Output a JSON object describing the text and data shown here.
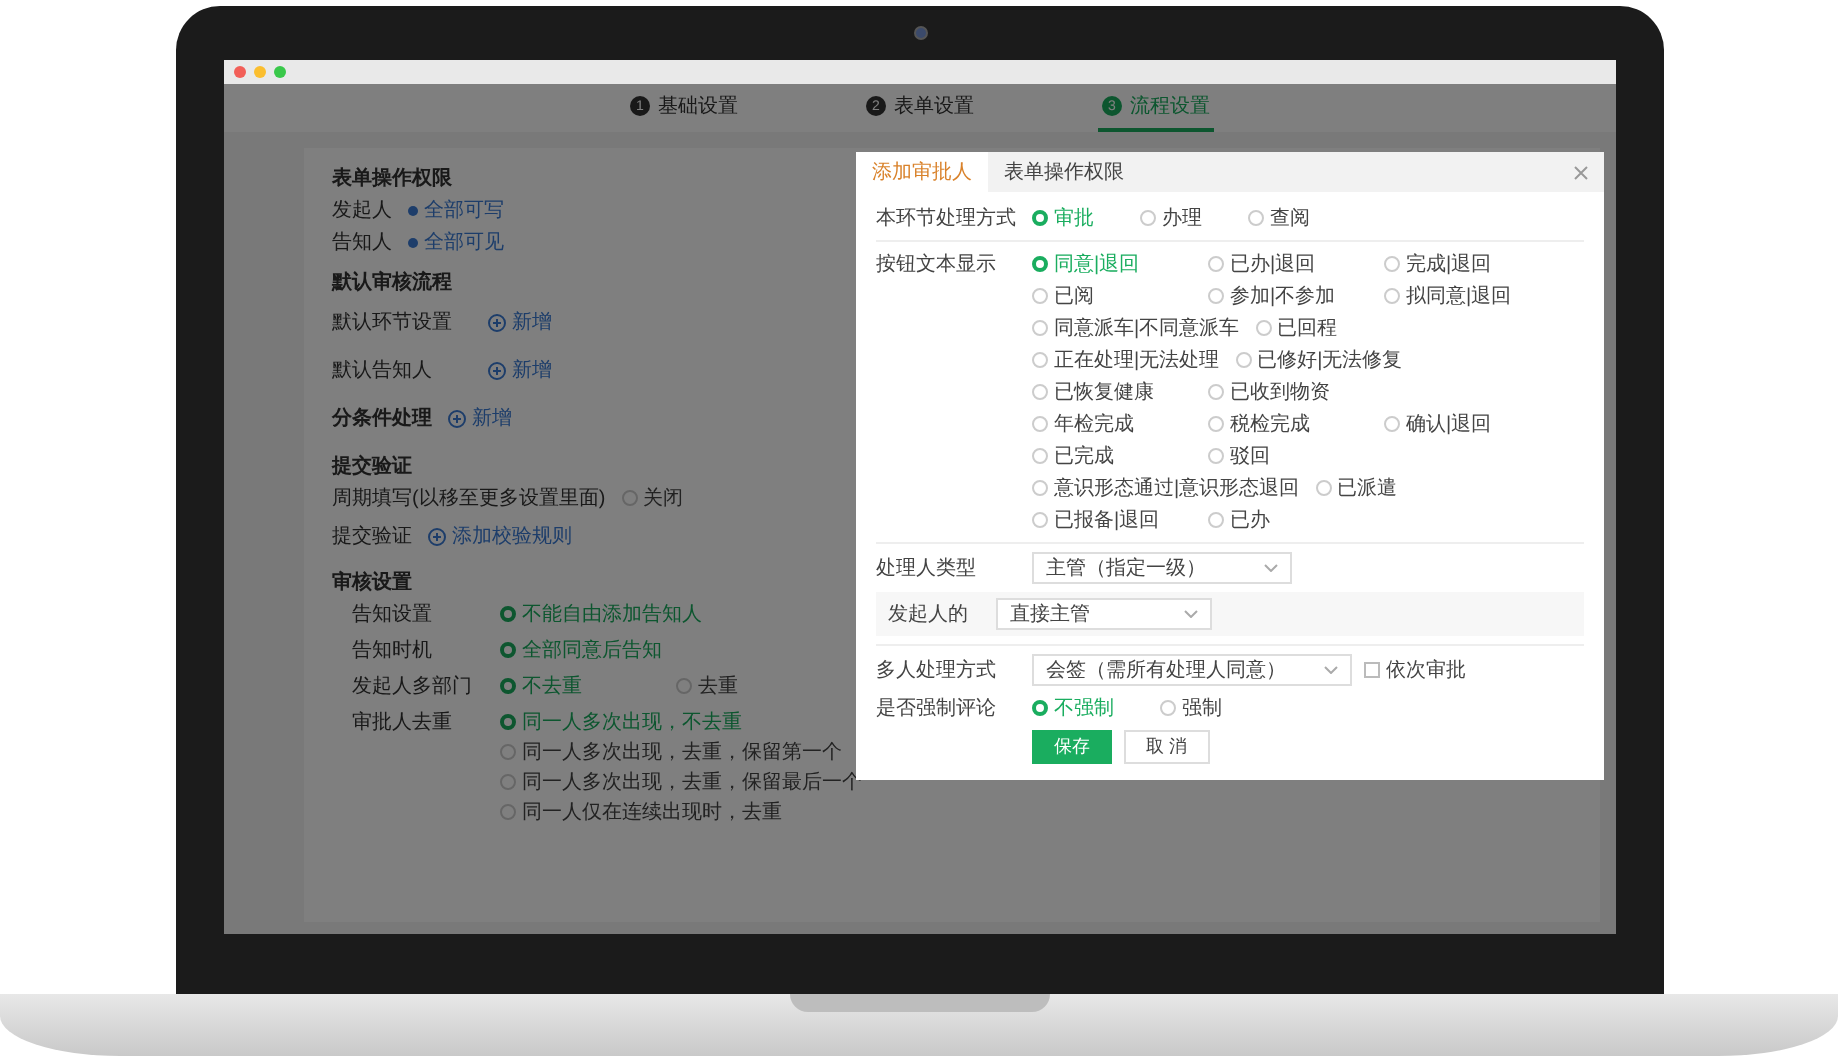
{
  "steps": [
    {
      "number": "1",
      "label": "基础设置",
      "selected": false
    },
    {
      "number": "2",
      "label": "表单设置",
      "selected": false
    },
    {
      "number": "3",
      "label": "流程设置",
      "selected": true
    }
  ],
  "form_permissions": {
    "title": "表单操作权限",
    "rows": [
      {
        "label": "发起人",
        "value": "全部可写"
      },
      {
        "label": "告知人",
        "value": "全部可见"
      }
    ]
  },
  "default_flow": {
    "title": "默认审核流程",
    "rows": [
      {
        "label": "默认环节设置",
        "action": "新增"
      },
      {
        "label": "默认告知人",
        "action": "新增"
      }
    ]
  },
  "branch": {
    "label": "分条件处理",
    "action": "新增"
  },
  "submit_check": {
    "title": "提交验证",
    "row_label": "周期填写(以移至更多设置里面)",
    "options": [
      {
        "label": "关闭",
        "selected": false
      }
    ]
  },
  "validation": {
    "label": "提交验证",
    "action": "添加校验规则"
  },
  "approval_settings": {
    "title": "审核设置",
    "rows": [
      {
        "label": "告知设置",
        "options": [
          {
            "label": "不能自由添加告知人",
            "selected": true
          }
        ]
      },
      {
        "label": "告知时机",
        "options": [
          {
            "label": "全部同意后告知",
            "selected": true
          }
        ]
      },
      {
        "label": "发起人多部门",
        "options": [
          {
            "label": "不去重",
            "selected": true
          },
          {
            "label": "去重",
            "selected": false
          }
        ]
      },
      {
        "label": "审批人去重",
        "options": [
          {
            "label": "同一人多次出现，不去重",
            "selected": true
          },
          {
            "label": "同一人多次出现，去重，保留第一个",
            "selected": false
          },
          {
            "label": "同一人多次出现，去重，保留最后一个",
            "selected": false
          },
          {
            "label": "同一人仅在连续出现时，去重",
            "selected": false
          }
        ]
      }
    ]
  },
  "modal": {
    "tabs": [
      {
        "label": "添加审批人",
        "selected": true
      },
      {
        "label": "表单操作权限",
        "selected": false
      }
    ],
    "method": {
      "label": "本环节处理方式",
      "options": [
        {
          "label": "审批",
          "selected": true
        },
        {
          "label": "办理",
          "selected": false
        },
        {
          "label": "查阅",
          "selected": false
        }
      ]
    },
    "button_text": {
      "label": "按钮文本显示",
      "rows": [
        [
          {
            "label": "同意|退回",
            "selected": true
          },
          {
            "label": "已办|退回",
            "selected": false
          },
          {
            "label": "完成|退回",
            "selected": false
          }
        ],
        [
          {
            "label": "已阅",
            "selected": false
          },
          {
            "label": "参加|不参加",
            "selected": false
          },
          {
            "label": "拟同意|退回",
            "selected": false
          }
        ],
        [
          {
            "label": "同意派车|不同意派车",
            "selected": false
          },
          {
            "label": "已回程",
            "selected": false
          }
        ],
        [
          {
            "label": "正在处理|无法处理",
            "selected": false
          },
          {
            "label": "已修好|无法修复",
            "selected": false
          }
        ],
        [
          {
            "label": "已恢复健康",
            "selected": false
          },
          {
            "label": "已收到物资",
            "selected": false
          }
        ],
        [
          {
            "label": "年检完成",
            "selected": false
          },
          {
            "label": "税检完成",
            "selected": false
          },
          {
            "label": "确认|退回",
            "selected": false
          }
        ],
        [
          {
            "label": "已完成",
            "selected": false
          },
          {
            "label": "驳回",
            "selected": false
          }
        ],
        [
          {
            "label": "意识形态通过|意识形态退回",
            "selected": false
          },
          {
            "label": "已派遣",
            "selected": false
          }
        ],
        [
          {
            "label": "已报备|退回",
            "selected": false
          },
          {
            "label": "已办",
            "selected": false
          }
        ]
      ]
    },
    "handler_type": {
      "label": "处理人类型",
      "value": "主管（指定一级）",
      "sub_label": "发起人的",
      "sub_value": "直接主管"
    },
    "multi": {
      "label": "多人处理方式",
      "value": "会签（需所有处理人同意）",
      "checkbox": {
        "label": "依次审批",
        "checked": false
      }
    },
    "force_comment": {
      "label": "是否强制评论",
      "options": [
        {
          "label": "不强制",
          "selected": true
        },
        {
          "label": "强制",
          "selected": false
        }
      ]
    },
    "buttons": [
      {
        "label": "保存",
        "kind": "primary"
      },
      {
        "label": "取 消",
        "kind": "default"
      }
    ]
  }
}
